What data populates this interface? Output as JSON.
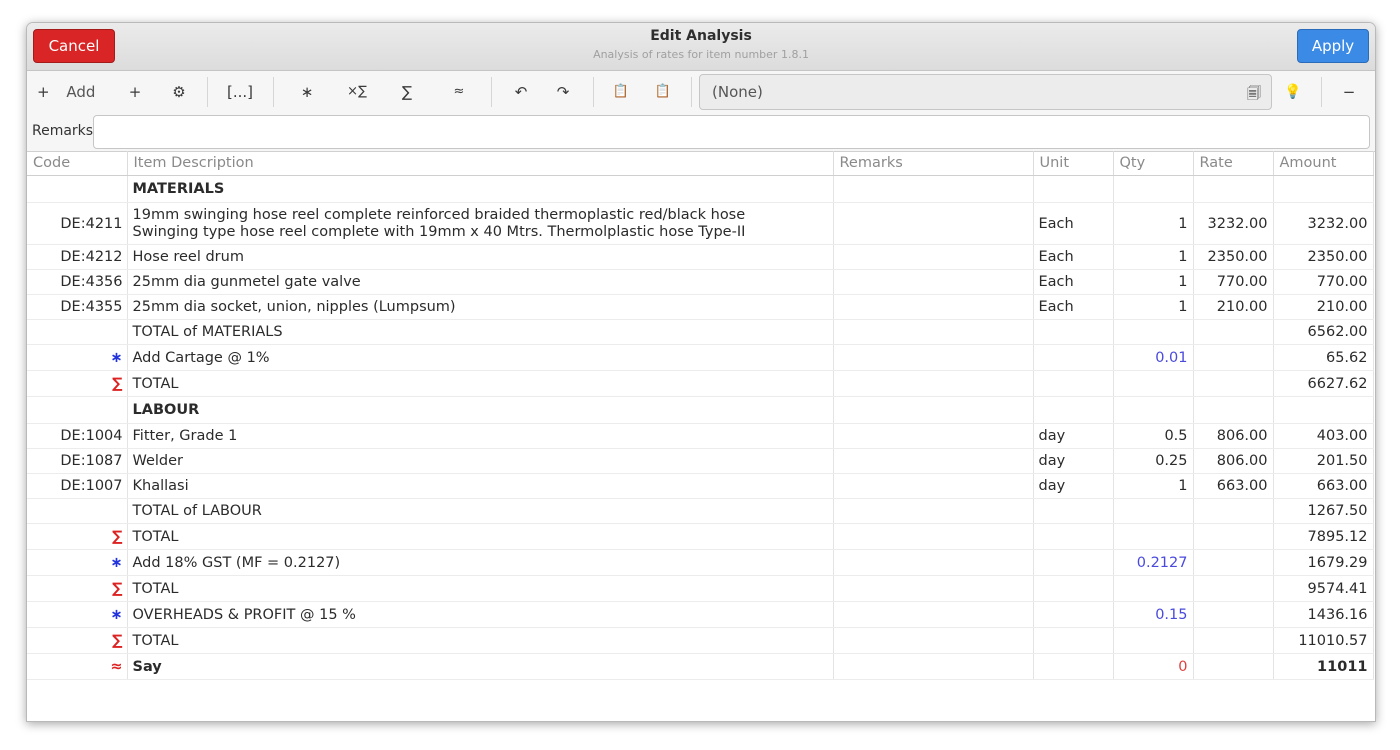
{
  "header": {
    "cancel_label": "Cancel",
    "title": "Edit Analysis",
    "subtitle": "Analysis of rates for item number 1.8.1",
    "apply_label": "Apply"
  },
  "toolbar": {
    "add_label": "Add",
    "add_glyph": "+",
    "plus_glyph": "+",
    "settings_glyph": "⚙",
    "brackets_glyph": "[...]",
    "star_glyph": "∗",
    "times_sum_glyph": "×∑",
    "sum_glyph": "∑",
    "approx_glyph": "≈",
    "undo_glyph": "↶",
    "redo_glyph": "↷",
    "copy_glyph": "📋",
    "paste_glyph": "📋",
    "combo_value": "(None)",
    "combo_glyph": "🗐",
    "bulb_glyph": "💡",
    "minus_glyph": "−"
  },
  "remarks": {
    "label": "Remarks:",
    "value": ""
  },
  "table": {
    "columns": [
      "Code",
      "Item Description",
      "Remarks",
      "Unit",
      "Qty",
      "Rate",
      "Amount"
    ],
    "rows": [
      {
        "code": "",
        "sym": "",
        "desc": "MATERIALS",
        "remarks": "",
        "unit": "",
        "qty": "",
        "rate": "",
        "amount": "",
        "kind": "heading"
      },
      {
        "code": "DE:4211",
        "sym": "",
        "desc": "19mm swinging hose reel complete reinforced braided thermoplastic red/black hose",
        "desc2": "Swinging type hose reel complete with 19mm x 40 Mtrs. Thermolplastic hose Type-II",
        "remarks": "",
        "unit": "Each",
        "qty": "1",
        "rate": "3232.00",
        "amount": "3232.00",
        "kind": "item2"
      },
      {
        "code": "DE:4212",
        "sym": "",
        "desc": "Hose reel drum",
        "remarks": "",
        "unit": "Each",
        "qty": "1",
        "rate": "2350.00",
        "amount": "2350.00",
        "kind": "item"
      },
      {
        "code": "DE:4356",
        "sym": "",
        "desc": "25mm dia gunmetel gate valve",
        "remarks": "",
        "unit": "Each",
        "qty": "1",
        "rate": "770.00",
        "amount": "770.00",
        "kind": "item"
      },
      {
        "code": "DE:4355",
        "sym": "",
        "desc": "25mm dia socket, union, nipples (Lumpsum)",
        "remarks": "",
        "unit": "Each",
        "qty": "1",
        "rate": "210.00",
        "amount": "210.00",
        "kind": "item"
      },
      {
        "code": "",
        "sym": "",
        "desc": "TOTAL of MATERIALS",
        "remarks": "",
        "unit": "",
        "qty": "",
        "rate": "",
        "amount": "6562.00",
        "kind": "item"
      },
      {
        "code": "",
        "sym": "∗",
        "desc": "Add Cartage @ 1%",
        "remarks": "",
        "unit": "",
        "qty": "0.01",
        "rate": "",
        "amount": "65.62",
        "kind": "factor"
      },
      {
        "code": "",
        "sym": "∑",
        "desc": "TOTAL",
        "remarks": "",
        "unit": "",
        "qty": "",
        "rate": "",
        "amount": "6627.62",
        "kind": "sum"
      },
      {
        "code": "",
        "sym": "",
        "desc": "LABOUR",
        "remarks": "",
        "unit": "",
        "qty": "",
        "rate": "",
        "amount": "",
        "kind": "heading"
      },
      {
        "code": "DE:1004",
        "sym": "",
        "desc": "Fitter, Grade 1",
        "remarks": "",
        "unit": "day",
        "qty": "0.5",
        "rate": "806.00",
        "amount": "403.00",
        "kind": "item"
      },
      {
        "code": "DE:1087",
        "sym": "",
        "desc": "Welder",
        "remarks": "",
        "unit": "day",
        "qty": "0.25",
        "rate": "806.00",
        "amount": "201.50",
        "kind": "item"
      },
      {
        "code": "DE:1007",
        "sym": "",
        "desc": "Khallasi",
        "remarks": "",
        "unit": "day",
        "qty": "1",
        "rate": "663.00",
        "amount": "663.00",
        "kind": "item"
      },
      {
        "code": "",
        "sym": "",
        "desc": "TOTAL of LABOUR",
        "remarks": "",
        "unit": "",
        "qty": "",
        "rate": "",
        "amount": "1267.50",
        "kind": "item"
      },
      {
        "code": "",
        "sym": "∑",
        "desc": "TOTAL",
        "remarks": "",
        "unit": "",
        "qty": "",
        "rate": "",
        "amount": "7895.12",
        "kind": "sum"
      },
      {
        "code": "",
        "sym": "∗",
        "desc": "Add 18% GST (MF = 0.2127)",
        "remarks": "",
        "unit": "",
        "qty": "0.2127",
        "rate": "",
        "amount": "1679.29",
        "kind": "factor"
      },
      {
        "code": "",
        "sym": "∑",
        "desc": "TOTAL",
        "remarks": "",
        "unit": "",
        "qty": "",
        "rate": "",
        "amount": "9574.41",
        "kind": "sum"
      },
      {
        "code": "",
        "sym": "∗",
        "desc": "OVERHEADS & PROFIT @ 15 %",
        "remarks": "",
        "unit": "",
        "qty": "0.15",
        "rate": "",
        "amount": "1436.16",
        "kind": "factor"
      },
      {
        "code": "",
        "sym": "∑",
        "desc": "TOTAL",
        "remarks": "",
        "unit": "",
        "qty": "",
        "rate": "",
        "amount": "11010.57",
        "kind": "sum"
      },
      {
        "code": "",
        "sym": "≈",
        "desc": "Say",
        "remarks": "",
        "unit": "",
        "qty": "0",
        "rate": "",
        "amount": "11011",
        "kind": "say"
      }
    ]
  },
  "colors": {
    "cancel": "#d92525",
    "apply": "#3a8ae6",
    "factor_symbol": "#2233dd",
    "sum_symbol": "#dd2222",
    "factor_qty": "#4a4add",
    "say_qty": "#e04040"
  }
}
